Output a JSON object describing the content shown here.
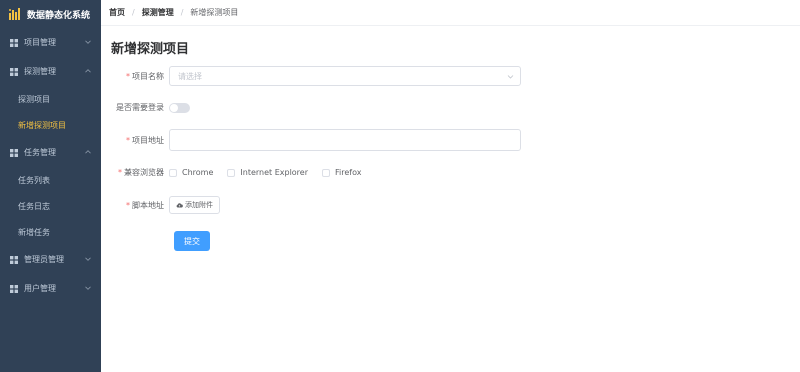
{
  "app": {
    "title": "数据静态化系统"
  },
  "sidebar": {
    "items": [
      {
        "label": "项目管理",
        "icon": "grid-icon",
        "expanded": false
      },
      {
        "label": "探测管理",
        "icon": "grid-icon",
        "expanded": true,
        "children": [
          {
            "label": "探测项目",
            "active": false
          },
          {
            "label": "新增探测项目",
            "active": true
          }
        ]
      },
      {
        "label": "任务管理",
        "icon": "grid-icon",
        "expanded": true,
        "children": [
          {
            "label": "任务列表"
          },
          {
            "label": "任务日志"
          },
          {
            "label": "新增任务"
          }
        ]
      },
      {
        "label": "管理员管理",
        "icon": "grid-icon",
        "expanded": false
      },
      {
        "label": "用户管理",
        "icon": "grid-icon",
        "expanded": false
      }
    ]
  },
  "breadcrumb": {
    "items": [
      "首页",
      "探测管理",
      "新增探测项目"
    ],
    "separator": "/"
  },
  "page": {
    "title": "新增探测项目"
  },
  "form": {
    "project_name": {
      "label": "项目名称",
      "required": true,
      "placeholder": "请选择",
      "value": ""
    },
    "need_login": {
      "label": "是否需要登录",
      "value": false
    },
    "project_url": {
      "label": "项目地址",
      "required": true,
      "value": ""
    },
    "browsers": {
      "label": "兼容浏览器",
      "required": true,
      "options": [
        {
          "label": "Chrome",
          "checked": false
        },
        {
          "label": "Internet Explorer",
          "checked": false
        },
        {
          "label": "Firefox",
          "checked": false
        }
      ]
    },
    "script": {
      "label": "脚本地址",
      "required": true,
      "button_label": "添加附件"
    },
    "submit_label": "提交"
  },
  "colors": {
    "sidebar_bg": "#304156",
    "active_menu": "#f4c242",
    "primary": "#409eff",
    "required": "#f56c6c"
  }
}
